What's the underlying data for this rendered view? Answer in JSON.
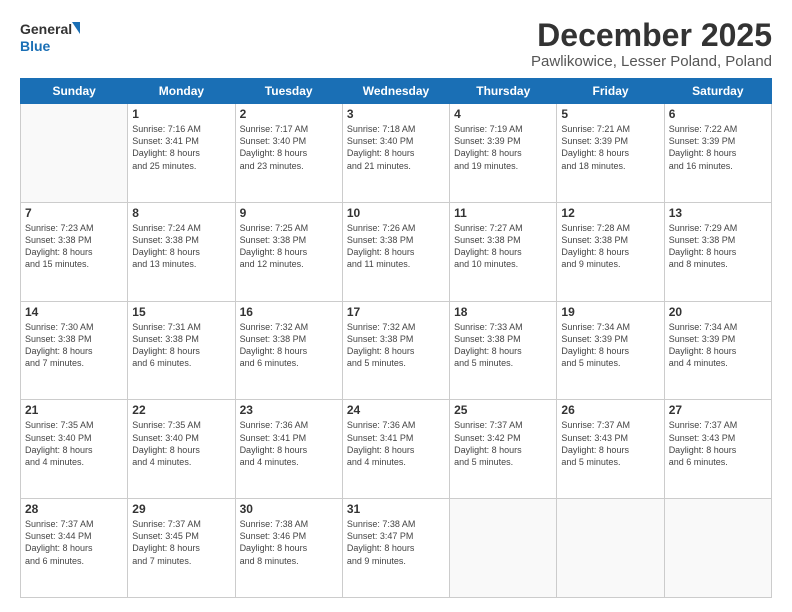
{
  "logo": {
    "line1": "General",
    "line2": "Blue"
  },
  "title": "December 2025",
  "subtitle": "Pawlikowice, Lesser Poland, Poland",
  "days": [
    "Sunday",
    "Monday",
    "Tuesday",
    "Wednesday",
    "Thursday",
    "Friday",
    "Saturday"
  ],
  "weeks": [
    [
      {
        "num": "",
        "info": ""
      },
      {
        "num": "1",
        "info": "Sunrise: 7:16 AM\nSunset: 3:41 PM\nDaylight: 8 hours\nand 25 minutes."
      },
      {
        "num": "2",
        "info": "Sunrise: 7:17 AM\nSunset: 3:40 PM\nDaylight: 8 hours\nand 23 minutes."
      },
      {
        "num": "3",
        "info": "Sunrise: 7:18 AM\nSunset: 3:40 PM\nDaylight: 8 hours\nand 21 minutes."
      },
      {
        "num": "4",
        "info": "Sunrise: 7:19 AM\nSunset: 3:39 PM\nDaylight: 8 hours\nand 19 minutes."
      },
      {
        "num": "5",
        "info": "Sunrise: 7:21 AM\nSunset: 3:39 PM\nDaylight: 8 hours\nand 18 minutes."
      },
      {
        "num": "6",
        "info": "Sunrise: 7:22 AM\nSunset: 3:39 PM\nDaylight: 8 hours\nand 16 minutes."
      }
    ],
    [
      {
        "num": "7",
        "info": "Sunrise: 7:23 AM\nSunset: 3:38 PM\nDaylight: 8 hours\nand 15 minutes."
      },
      {
        "num": "8",
        "info": "Sunrise: 7:24 AM\nSunset: 3:38 PM\nDaylight: 8 hours\nand 13 minutes."
      },
      {
        "num": "9",
        "info": "Sunrise: 7:25 AM\nSunset: 3:38 PM\nDaylight: 8 hours\nand 12 minutes."
      },
      {
        "num": "10",
        "info": "Sunrise: 7:26 AM\nSunset: 3:38 PM\nDaylight: 8 hours\nand 11 minutes."
      },
      {
        "num": "11",
        "info": "Sunrise: 7:27 AM\nSunset: 3:38 PM\nDaylight: 8 hours\nand 10 minutes."
      },
      {
        "num": "12",
        "info": "Sunrise: 7:28 AM\nSunset: 3:38 PM\nDaylight: 8 hours\nand 9 minutes."
      },
      {
        "num": "13",
        "info": "Sunrise: 7:29 AM\nSunset: 3:38 PM\nDaylight: 8 hours\nand 8 minutes."
      }
    ],
    [
      {
        "num": "14",
        "info": "Sunrise: 7:30 AM\nSunset: 3:38 PM\nDaylight: 8 hours\nand 7 minutes."
      },
      {
        "num": "15",
        "info": "Sunrise: 7:31 AM\nSunset: 3:38 PM\nDaylight: 8 hours\nand 6 minutes."
      },
      {
        "num": "16",
        "info": "Sunrise: 7:32 AM\nSunset: 3:38 PM\nDaylight: 8 hours\nand 6 minutes."
      },
      {
        "num": "17",
        "info": "Sunrise: 7:32 AM\nSunset: 3:38 PM\nDaylight: 8 hours\nand 5 minutes."
      },
      {
        "num": "18",
        "info": "Sunrise: 7:33 AM\nSunset: 3:38 PM\nDaylight: 8 hours\nand 5 minutes."
      },
      {
        "num": "19",
        "info": "Sunrise: 7:34 AM\nSunset: 3:39 PM\nDaylight: 8 hours\nand 5 minutes."
      },
      {
        "num": "20",
        "info": "Sunrise: 7:34 AM\nSunset: 3:39 PM\nDaylight: 8 hours\nand 4 minutes."
      }
    ],
    [
      {
        "num": "21",
        "info": "Sunrise: 7:35 AM\nSunset: 3:40 PM\nDaylight: 8 hours\nand 4 minutes."
      },
      {
        "num": "22",
        "info": "Sunrise: 7:35 AM\nSunset: 3:40 PM\nDaylight: 8 hours\nand 4 minutes."
      },
      {
        "num": "23",
        "info": "Sunrise: 7:36 AM\nSunset: 3:41 PM\nDaylight: 8 hours\nand 4 minutes."
      },
      {
        "num": "24",
        "info": "Sunrise: 7:36 AM\nSunset: 3:41 PM\nDaylight: 8 hours\nand 4 minutes."
      },
      {
        "num": "25",
        "info": "Sunrise: 7:37 AM\nSunset: 3:42 PM\nDaylight: 8 hours\nand 5 minutes."
      },
      {
        "num": "26",
        "info": "Sunrise: 7:37 AM\nSunset: 3:43 PM\nDaylight: 8 hours\nand 5 minutes."
      },
      {
        "num": "27",
        "info": "Sunrise: 7:37 AM\nSunset: 3:43 PM\nDaylight: 8 hours\nand 6 minutes."
      }
    ],
    [
      {
        "num": "28",
        "info": "Sunrise: 7:37 AM\nSunset: 3:44 PM\nDaylight: 8 hours\nand 6 minutes."
      },
      {
        "num": "29",
        "info": "Sunrise: 7:37 AM\nSunset: 3:45 PM\nDaylight: 8 hours\nand 7 minutes."
      },
      {
        "num": "30",
        "info": "Sunrise: 7:38 AM\nSunset: 3:46 PM\nDaylight: 8 hours\nand 8 minutes."
      },
      {
        "num": "31",
        "info": "Sunrise: 7:38 AM\nSunset: 3:47 PM\nDaylight: 8 hours\nand 9 minutes."
      },
      {
        "num": "",
        "info": ""
      },
      {
        "num": "",
        "info": ""
      },
      {
        "num": "",
        "info": ""
      }
    ]
  ]
}
